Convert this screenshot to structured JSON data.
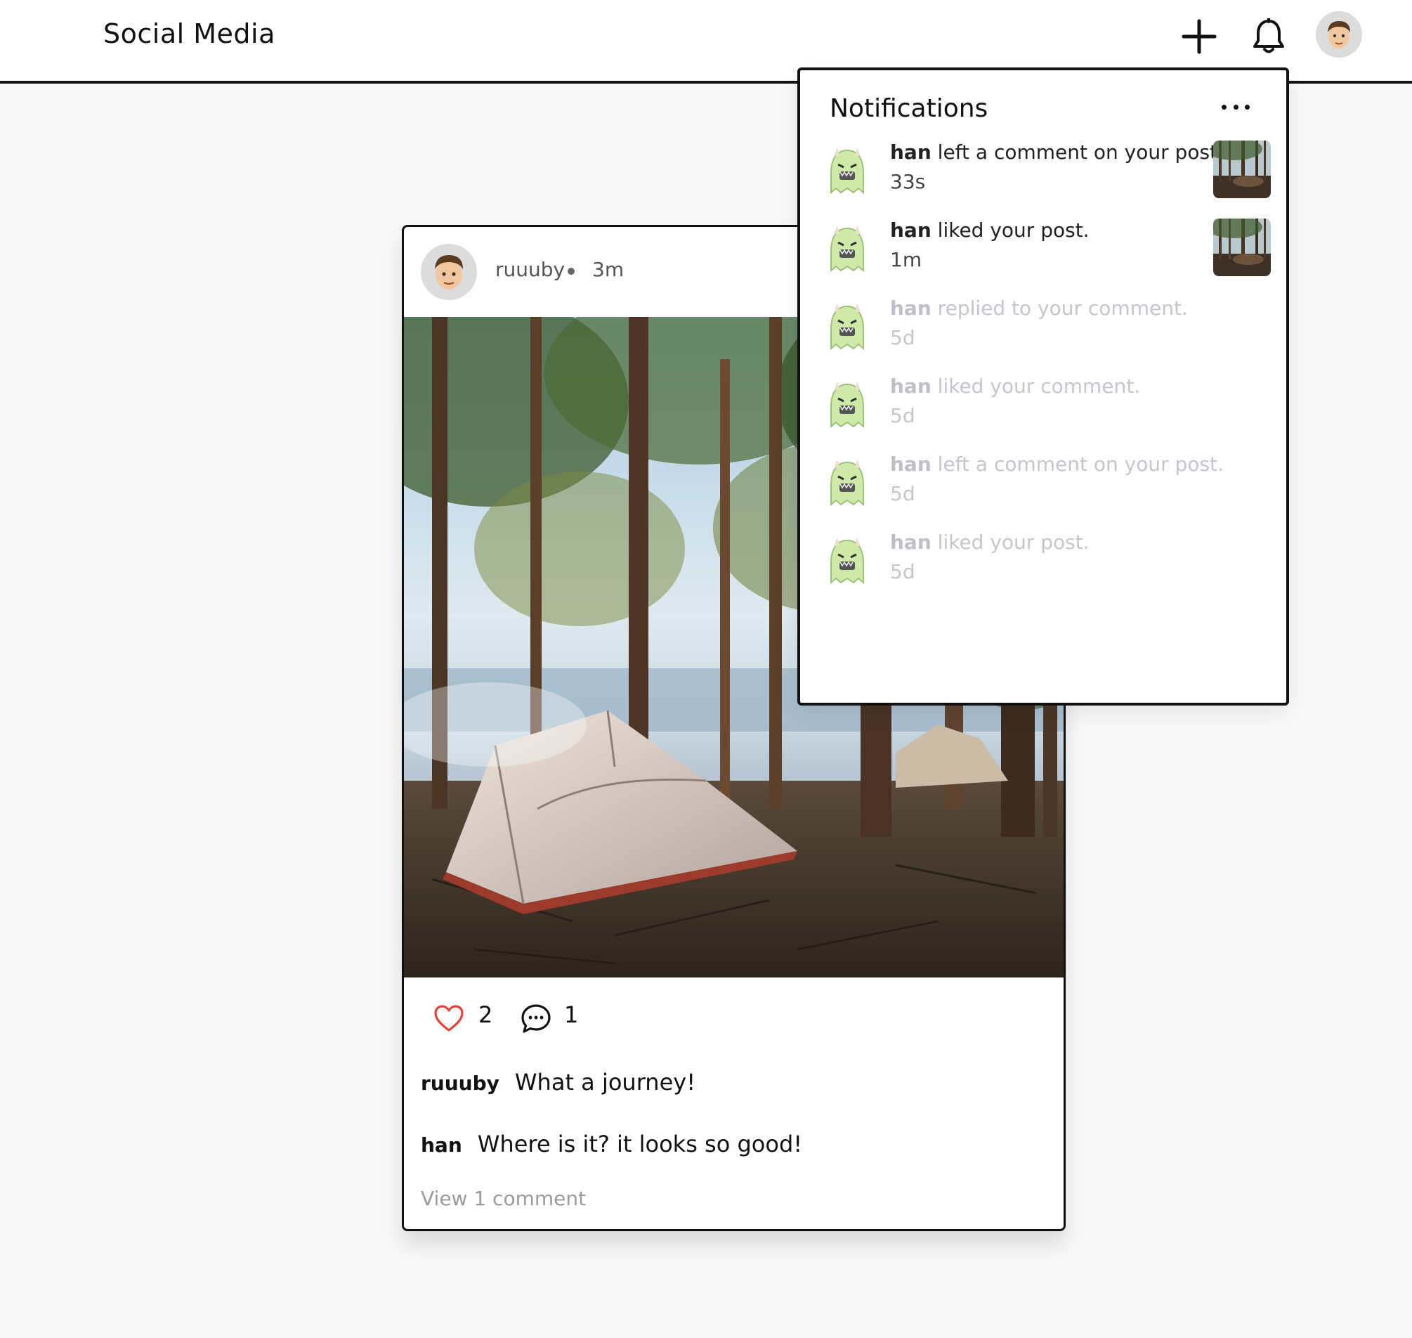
{
  "app": {
    "title": "Social Media"
  },
  "header": {
    "add_icon": "plus-icon",
    "bell_icon": "bell-icon",
    "avatar_icon": "user-avatar"
  },
  "post": {
    "username": "ruuuby",
    "time": "3m",
    "likes": "2",
    "comments_count": "1",
    "caption_user": "ruuuby",
    "caption_text": "What a journey!",
    "comment_user": "han",
    "comment_text": "Where is it? it looks so good!",
    "view_comments": "View 1 comment",
    "carousel_dot_color": "#1e7be8",
    "like_icon_color": "#e0443e"
  },
  "notifications": {
    "title": "Notifications",
    "menu_icon": "more-icon",
    "items": [
      {
        "user": "han",
        "action": " left a comment on your post.",
        "time": "33s",
        "read": false,
        "has_thumb": true
      },
      {
        "user": "han",
        "action": " liked your post.",
        "time": "1m",
        "read": false,
        "has_thumb": true
      },
      {
        "user": "han",
        "action": " replied to your comment.",
        "time": "5d",
        "read": true,
        "has_thumb": false
      },
      {
        "user": "han",
        "action": " liked your comment.",
        "time": "5d",
        "read": true,
        "has_thumb": false
      },
      {
        "user": "han",
        "action": " left a comment on your post.",
        "time": "5d",
        "read": true,
        "has_thumb": false
      },
      {
        "user": "han",
        "action": " liked your post.",
        "time": "5d",
        "read": true,
        "has_thumb": false
      }
    ]
  }
}
